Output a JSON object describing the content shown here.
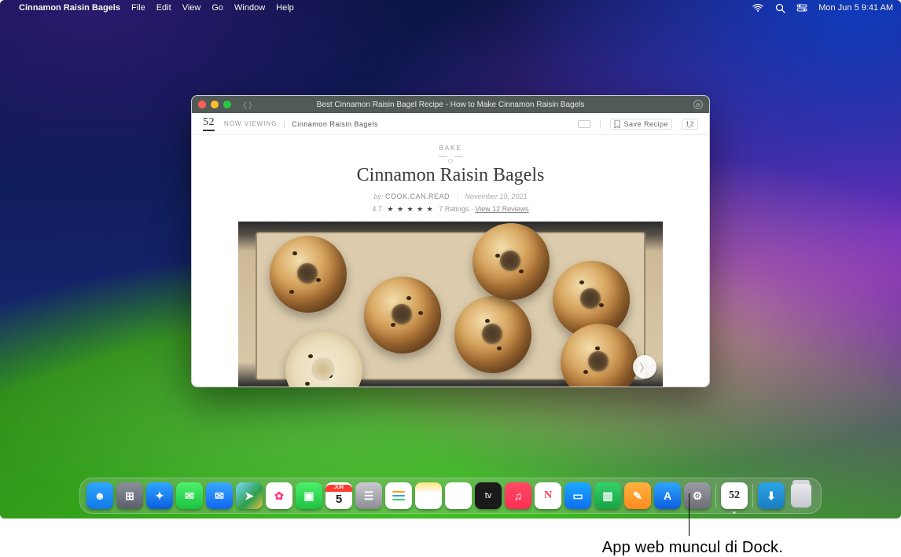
{
  "menubar": {
    "app_name": "Cinnamon Raisin Bagels",
    "items": [
      "File",
      "Edit",
      "View",
      "Go",
      "Window",
      "Help"
    ],
    "clock": "Mon Jun 5  9:41 AM"
  },
  "window": {
    "title": "Best Cinnamon Raisin Bagel Recipe - How to Make Cinnamon Raisin Bagels",
    "subheader": {
      "logo": "52",
      "now_viewing_label": "NOW VIEWING",
      "recipe_name": "Cinnamon Raisin Bagels",
      "save_label": "Save Recipe",
      "comment_count": "12"
    },
    "content": {
      "category": "BAKE",
      "title": "Cinnamon Raisin Bagels",
      "by_prefix": "by:",
      "author": "COOK.CAN.READ",
      "date": "November 19, 2021",
      "rating_value": "4.7",
      "stars": "★ ★ ★ ★ ★",
      "ratings_label": "7 Ratings",
      "reviews_link": "View 12 Reviews"
    }
  },
  "dock": {
    "apps": [
      {
        "name": "finder",
        "bg": "linear-gradient(180deg,#2ea6ff,#1179e8)",
        "glyph": "☻"
      },
      {
        "name": "launchpad",
        "bg": "linear-gradient(180deg,#8b8f9a,#5a5f6a)",
        "glyph": "⊞"
      },
      {
        "name": "safari",
        "bg": "linear-gradient(180deg,#2ea6ff,#0d5de0)",
        "glyph": "✦"
      },
      {
        "name": "messages",
        "bg": "linear-gradient(180deg,#4cf06c,#1cc241)",
        "glyph": "✉"
      },
      {
        "name": "mail",
        "bg": "linear-gradient(180deg,#39a8ff,#1164f0)",
        "glyph": "✉"
      },
      {
        "name": "maps",
        "bg": "linear-gradient(135deg,#7ad9ff,#2d9e4a 60%,#f2c14a)",
        "glyph": "➤"
      },
      {
        "name": "photos",
        "bg": "#fff",
        "glyph": "✿"
      },
      {
        "name": "facetime",
        "bg": "linear-gradient(180deg,#4cf06c,#1cc241)",
        "glyph": "▣"
      },
      {
        "name": "calendar",
        "bg": "#fff",
        "glyph_top": "JUN",
        "glyph": "5"
      },
      {
        "name": "contacts",
        "bg": "linear-gradient(180deg,#c9c9cf,#8b8b92)",
        "glyph": "☰"
      },
      {
        "name": "reminders",
        "bg": "#fff",
        "glyph": "☰"
      },
      {
        "name": "notes",
        "bg": "linear-gradient(180deg,#ffe27a,#fff 40%)",
        "glyph": "✎"
      },
      {
        "name": "freeform",
        "bg": "#fff",
        "glyph": "〰"
      },
      {
        "name": "tv",
        "bg": "#1a1a1a",
        "glyph": "tv"
      },
      {
        "name": "music",
        "bg": "linear-gradient(180deg,#ff4a63,#ff2d55)",
        "glyph": "♫"
      },
      {
        "name": "news",
        "bg": "#fff",
        "glyph": "N"
      },
      {
        "name": "keynote",
        "bg": "linear-gradient(180deg,#1ea9ff,#0d6ef0)",
        "glyph": "▭"
      },
      {
        "name": "numbers",
        "bg": "linear-gradient(180deg,#34d26a,#18a444)",
        "glyph": "▥"
      },
      {
        "name": "pages",
        "bg": "linear-gradient(180deg,#ffb23e,#ff8a1e)",
        "glyph": "✎"
      },
      {
        "name": "appstore",
        "bg": "linear-gradient(180deg,#2ea6ff,#0d5de0)",
        "glyph": "A"
      },
      {
        "name": "settings",
        "bg": "linear-gradient(180deg,#9b9ba3,#6c6c74)",
        "glyph": "⚙"
      }
    ],
    "webapp": {
      "name": "food52-webapp",
      "bg": "#fff",
      "glyph": "52"
    },
    "downloads": {
      "name": "downloads",
      "bg": "linear-gradient(180deg,#2aa4e6,#1b7bc0)",
      "glyph": "⬇"
    }
  },
  "callout": {
    "text": "App web muncul di Dock."
  }
}
